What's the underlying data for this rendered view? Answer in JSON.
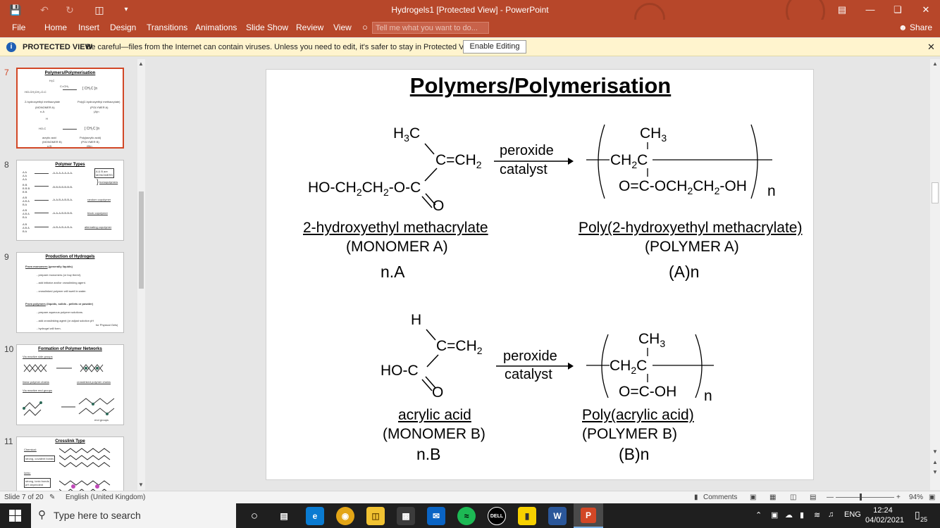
{
  "window": {
    "title": "Hydrogels1 [Protected View] - PowerPoint"
  },
  "ribbon": {
    "tabs": [
      "File",
      "Home",
      "Insert",
      "Design",
      "Transitions",
      "Animations",
      "Slide Show",
      "Review",
      "View"
    ],
    "tell_me_placeholder": "Tell me what you want to do...",
    "share": "Share"
  },
  "infobar": {
    "label": "PROTECTED VIEW",
    "message": "Be careful—files from the Internet can contain viruses. Unless you need to edit, it's safer to stay in Protected View.",
    "button": "Enable Editing"
  },
  "thumbnails": [
    {
      "num": "7",
      "title": "Polymers/Polymerisation"
    },
    {
      "num": "8",
      "title": "Polymer Types"
    },
    {
      "num": "9",
      "title": "Production of Hydrogels"
    },
    {
      "num": "10",
      "title": "Formation of Polymer Networks"
    },
    {
      "num": "11",
      "title": "Crosslink Type"
    }
  ],
  "slide": {
    "title": "Polymers/Polymerisation",
    "reaction_a": {
      "reagent_top": "peroxide",
      "reagent_bottom": "catalyst",
      "monomer_name": "2-hydroxyethyl methacrylate",
      "monomer_label": "(MONOMER A)",
      "monomer_qty": "n.A",
      "polymer_name": "Poly(2-hydroxyethyl methacrylate)",
      "polymer_label": "(POLYMER A)",
      "polymer_qty": "(A)n"
    },
    "reaction_b": {
      "reagent_top": "peroxide",
      "reagent_bottom": "catalyst",
      "monomer_name": "acrylic acid",
      "monomer_label": "(MONOMER B)",
      "monomer_qty": "n.B",
      "polymer_name": "Poly(acrylic acid)",
      "polymer_label": "(POLYMER B)",
      "polymer_qty": "(B)n"
    }
  },
  "statusbar": {
    "slide_count": "Slide 7 of 20",
    "language": "English (United Kingdom)",
    "comments": "Comments",
    "zoom": "94%"
  },
  "taskbar": {
    "search_placeholder": "Type here to search",
    "lang": "ENG",
    "time": "12:24",
    "date": "04/02/2021",
    "notifications": "25"
  },
  "colors": {
    "ribbon": "#b7472a",
    "infobar": "#fff4ce",
    "selected_thumb": "#d24726"
  }
}
